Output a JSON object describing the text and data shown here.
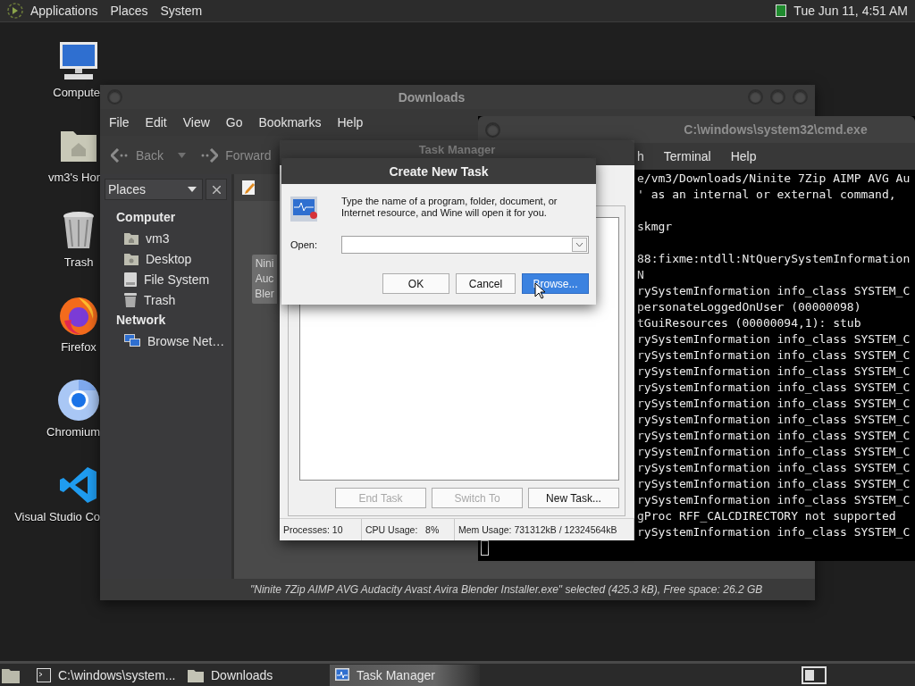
{
  "top_panel": {
    "menus": [
      "Applications",
      "Places",
      "System"
    ],
    "clock": "Tue Jun 11, 4:51 AM"
  },
  "desktop_icons": [
    {
      "label": "Compute",
      "kind": "computer"
    },
    {
      "label": "vm3's Hor",
      "kind": "home"
    },
    {
      "label": "Trash",
      "kind": "trash"
    },
    {
      "label": "Firefox",
      "kind": "firefox"
    },
    {
      "label": "Chromium",
      "kind": "chromium"
    },
    {
      "label": "Visual Studio Co",
      "kind": "vscode"
    }
  ],
  "file_manager": {
    "title": "Downloads",
    "menus": [
      "File",
      "Edit",
      "View",
      "Go",
      "Bookmarks",
      "Help"
    ],
    "back": "Back",
    "forward": "Forward",
    "places_selector": "Places",
    "sections": [
      {
        "title": "Computer",
        "items": [
          {
            "label": "vm3",
            "kind": "home"
          },
          {
            "label": "Desktop",
            "kind": "desktop"
          },
          {
            "label": "File System",
            "kind": "drive"
          },
          {
            "label": "Trash",
            "kind": "trash"
          }
        ]
      },
      {
        "title": "Network",
        "items": [
          {
            "label": "Browse Net…",
            "kind": "network"
          }
        ]
      }
    ],
    "file": {
      "label": "Nini Auc Bler",
      "selected": true
    },
    "status": "\"Ninite 7Zip AIMP AVG Audacity Avast Avira Blender Installer.exe\" selected (425.3 kB), Free space: 26.2 GB"
  },
  "terminal": {
    "title": "C:\\windows\\system32\\cmd.exe",
    "menus": [
      "h",
      "Terminal",
      "Help"
    ],
    "blocks": [
      [
        "e/vm3/Downloads/Ninite 7Zip AIMP AVG Au",
        "' as an internal or external command,"
      ],
      [
        "skmgr"
      ],
      [
        "88:fixme:ntdll:NtQuerySystemInformation",
        "N",
        "rySystemInformation info_class SYSTEM_C",
        "personateLoggedOnUser (00000098)",
        "tGuiResources (00000094,1): stub",
        "rySystemInformation info_class SYSTEM_C",
        "rySystemInformation info_class SYSTEM_C",
        "rySystemInformation info_class SYSTEM_C",
        "rySystemInformation info_class SYSTEM_C",
        "rySystemInformation info_class SYSTEM_C",
        "rySystemInformation info_class SYSTEM_C",
        "rySystemInformation info_class SYSTEM_C",
        "rySystemInformation info_class SYSTEM_C",
        "rySystemInformation info_class SYSTEM_C",
        "rySystemInformation info_class SYSTEM_C",
        "rySystemInformation info_class SYSTEM_C",
        "gProc RFF_CALCDIRECTORY not supported",
        "rySystemInformation info_class SYSTEM_C"
      ]
    ]
  },
  "task_manager": {
    "title": "Task Manager",
    "buttons": [
      {
        "label": "End Task",
        "disabled": true
      },
      {
        "label": "Switch To",
        "disabled": true
      },
      {
        "label": "New Task...",
        "disabled": false
      }
    ],
    "status": [
      "Processes: 10",
      "CPU Usage:   8%",
      "Mem Usage: 731312kB / 12324564kB"
    ]
  },
  "dialog": {
    "title": "Create New Task",
    "message": "Type the name of a program, folder, document, or Internet resource, and Wine will open it for you.",
    "open_label": "Open:",
    "buttons": [
      {
        "label": "OK",
        "selected": false
      },
      {
        "label": "Cancel",
        "selected": false
      },
      {
        "label": "Browse...",
        "selected": true
      }
    ]
  },
  "taskbar": {
    "items": [
      {
        "label": "C:\\windows\\system...",
        "kind": "terminal",
        "selected": false
      },
      {
        "label": "Downloads",
        "kind": "folder",
        "selected": false
      },
      {
        "label": "Task Manager",
        "kind": "taskmgr",
        "selected": true
      }
    ]
  }
}
